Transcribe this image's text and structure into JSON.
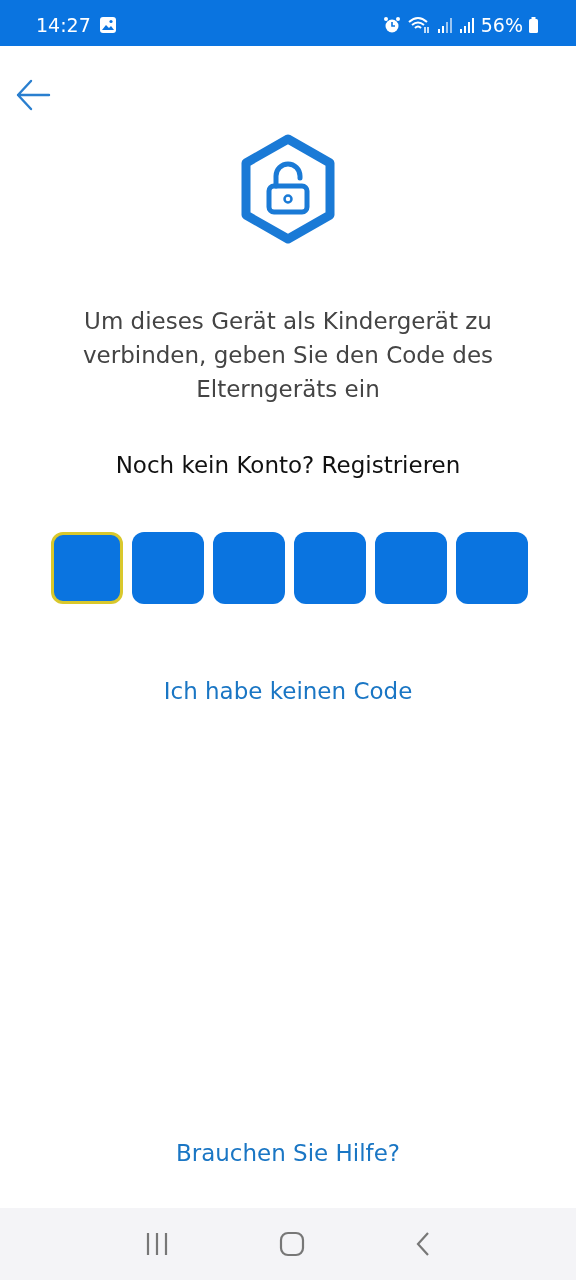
{
  "status_bar": {
    "time": "14:27",
    "battery": "56%"
  },
  "message": "Um dieses Gerät als Kindergerät zu verbinden, geben Sie den Code des Elterngeräts ein",
  "register_prompt": "Noch kein Konto? Registrieren",
  "code_boxes": [
    {
      "selected": true
    },
    {
      "selected": false
    },
    {
      "selected": false
    },
    {
      "selected": false
    },
    {
      "selected": false
    },
    {
      "selected": false
    }
  ],
  "no_code_link": "Ich habe keinen Code",
  "help_link": "Brauchen Sie Hilfe?"
}
